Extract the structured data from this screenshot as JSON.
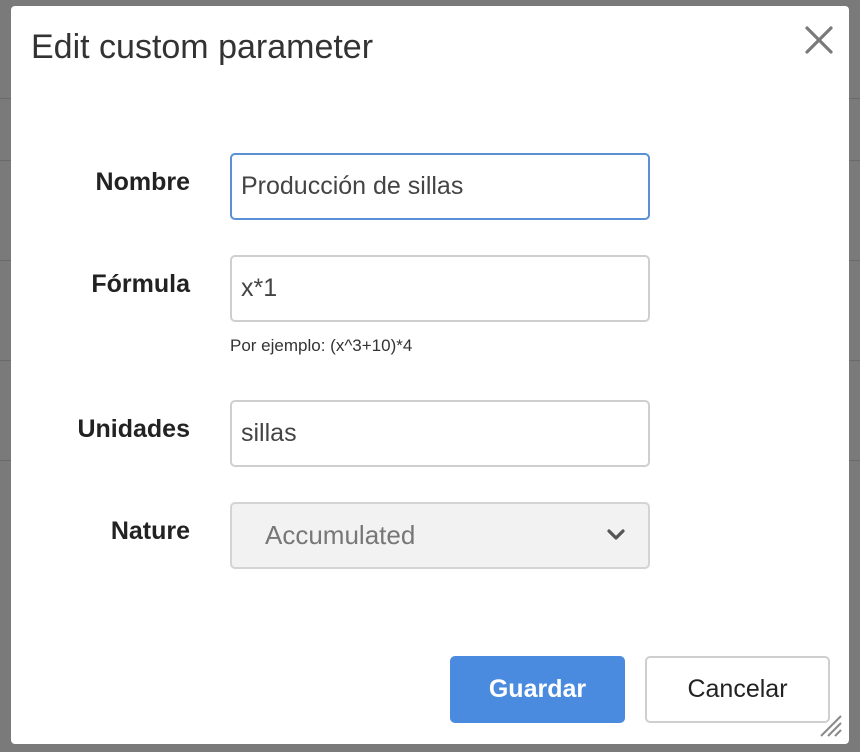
{
  "dialog": {
    "title": "Edit custom parameter",
    "close_icon": "close-icon"
  },
  "form": {
    "nombre": {
      "label": "Nombre",
      "value": "Producción de sillas"
    },
    "formula": {
      "label": "Fórmula",
      "value": "x*1",
      "help": "Por ejemplo: (x^3+10)*4"
    },
    "unidades": {
      "label": "Unidades",
      "value": "sillas"
    },
    "nature": {
      "label": "Nature",
      "selected": "Accumulated",
      "icon": "chevron-down-icon"
    }
  },
  "actions": {
    "save_label": "Guardar",
    "cancel_label": "Cancelar"
  },
  "colors": {
    "primary": "#4a8bdf",
    "focus_border": "#5b8fd6",
    "overlay": "#7a7a7a"
  }
}
